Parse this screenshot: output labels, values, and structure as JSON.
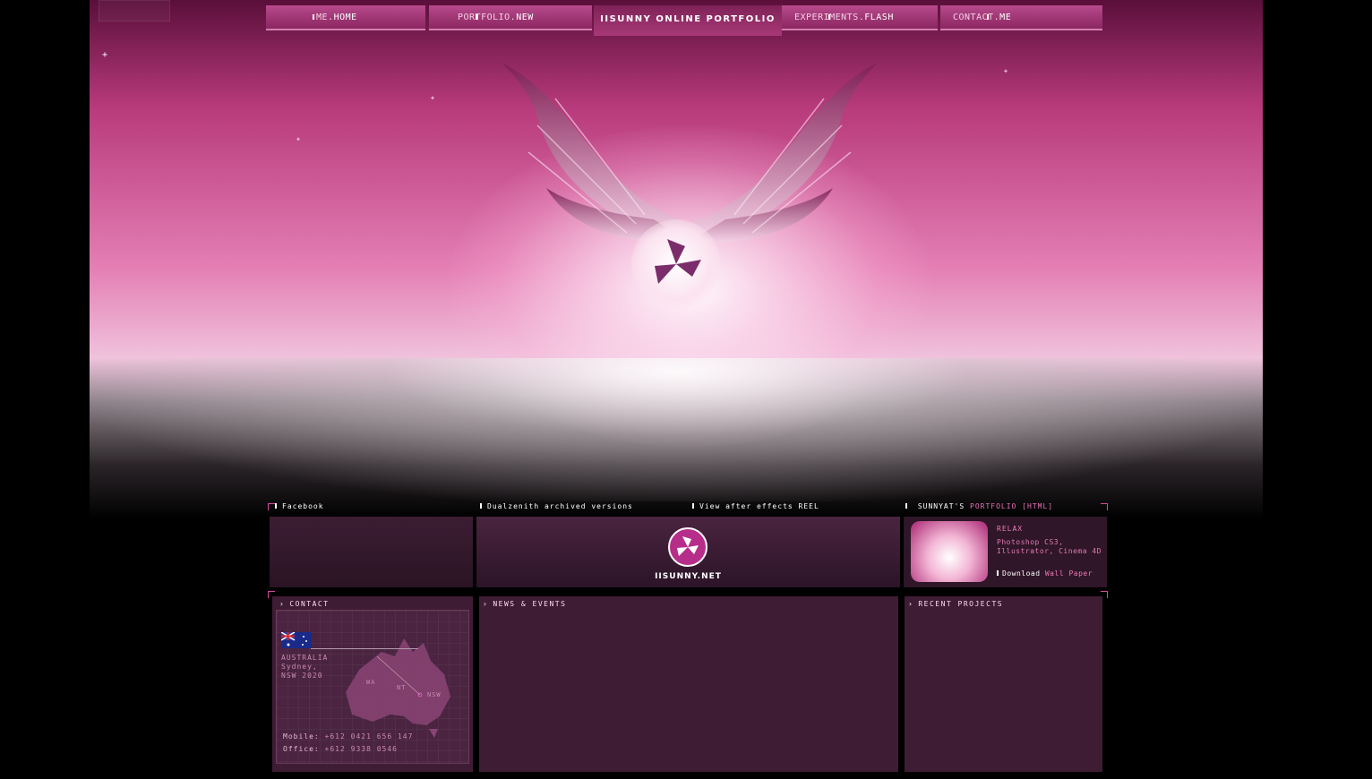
{
  "nav": {
    "items": [
      {
        "prefix": "ME.",
        "label": "HOME"
      },
      {
        "prefix": "PORTFOLIO.",
        "label": "NEW"
      },
      {
        "prefix": "EXPERIMENTS.",
        "label": "FLASH"
      },
      {
        "prefix": "CONTACT.",
        "label": "ME"
      }
    ],
    "title": "IISUNNY ONLINE PORTFOLIO"
  },
  "sections": {
    "facebook": "Facebook",
    "archived": "Dualzenith archived versions",
    "reel": "View after effects REEL",
    "portfolio_prefix": "SUNNYAT'S",
    "portfolio_label": "PORTFOLIO [HTML]"
  },
  "banner": {
    "site_name": "IISUNNY.NET"
  },
  "wallpaper": {
    "title": "RELAX",
    "tools": "Photoshop CS3, Illustrator, Cinema 4D",
    "download_prefix": "Download",
    "download_label": "Wall Paper"
  },
  "contact": {
    "heading": "CONTACT",
    "country": "AUSTRALIA",
    "city": "Sydney,",
    "postcode": "NSW 2020",
    "mobile_label": "Mobile:",
    "mobile": "+612 0421 656 147",
    "office_label": "Office:",
    "office": "+612 9338 0546",
    "map_labels": [
      "WA",
      "NT",
      "NSW"
    ]
  },
  "news": {
    "heading": "NEWS & EVENTS"
  },
  "projects": {
    "heading": "RECENT PROJECTS"
  },
  "colors": {
    "accent": "#d7489d",
    "panel": "#3e1d34",
    "nav": "#a83877"
  }
}
